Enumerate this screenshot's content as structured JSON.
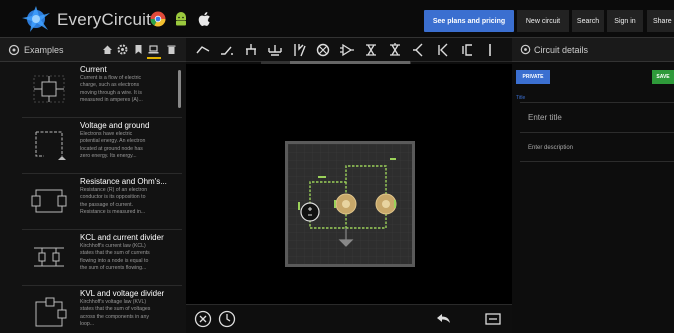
{
  "app": {
    "name": "EveryCircuit",
    "platform_icons": [
      "chrome-icon",
      "android-icon",
      "apple-icon"
    ]
  },
  "topnav": {
    "plans_label": "See plans and pricing",
    "new_circuit": "New circuit",
    "search": "Search",
    "sign_in": "Sign in",
    "share": "Share"
  },
  "left_panel": {
    "title": "Examples",
    "header_icons": [
      "home-icon",
      "gear-icon",
      "bookmark-icon",
      "laptop-icon",
      "trash-icon"
    ],
    "items": [
      {
        "title": "Current",
        "desc": "Current is a flow of electric\ncharge, such as electrons\nmoving through a wire. It is\nmeasured in amperes (A)..."
      },
      {
        "title": "Voltage and ground",
        "desc": "Electrons have electric\npotential energy. An electron\nlocated at ground node has\nzero energy. Its energy..."
      },
      {
        "title": "Resistance and Ohm's...",
        "desc": "Resistance (R) of an electron\nconductor is its opposition to\nthe passage of current.\nResistance is measured in..."
      },
      {
        "title": "KCL and current divider",
        "desc": "Kirchhoff's current law (KCL)\nstates that the sum of currents\nflowing into a node is equal to\nthe sum of currents flowing..."
      },
      {
        "title": "KVL and voltage divider",
        "desc": "Kirchhoff's voltage law (KVL)\nstates that the sum of voltages\nacross the components in any\nloop..."
      }
    ]
  },
  "toolbar": {
    "tools": [
      "wire-icon",
      "switch-icon",
      "ground-icon",
      "source-icon",
      "resistor-icon",
      "current-source-icon",
      "amplifier-icon",
      "transistor-icon",
      "transistor-alt-icon",
      "diode-icon",
      "diode-alt-icon",
      "capacitor-icon",
      "more-icon"
    ]
  },
  "right_panel": {
    "title": "Circuit details",
    "public_label": "PRIVATE",
    "save_label": "SAVE",
    "section_label": "Title",
    "title_placeholder": "Enter title",
    "description_placeholder": "Enter description"
  },
  "colors": {
    "accent": "#3b6fd0",
    "wire": "#9bd15a",
    "save": "#2e9a3a",
    "bulb": "#c8a86a"
  }
}
